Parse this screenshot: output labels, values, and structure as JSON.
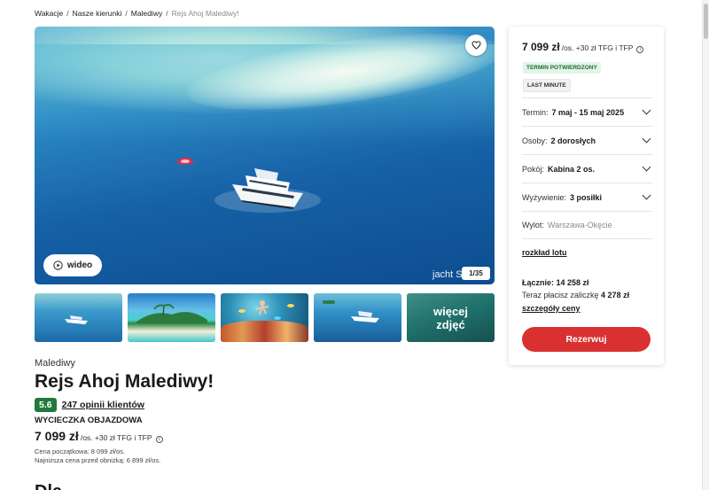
{
  "breadcrumb": {
    "items": [
      "Wakacje",
      "Nasze kierunki",
      "Malediwy"
    ],
    "current": "Rejs Ahoj Malediwy!",
    "separator": "/"
  },
  "gallery": {
    "video_label": "wideo",
    "watermark": "jacht S",
    "counter": "1/35",
    "more_photos": "więcej zdjęć"
  },
  "offer": {
    "destination": "Malediwy",
    "title": "Rejs Ahoj Malediwy!",
    "rating": "5.6",
    "reviews": "247 opinii klientów",
    "trip_type": "WYCIECZKA OBJAZDOWA",
    "price": "7 099 zł",
    "price_suffix": "/os. +30 zł TFG i TFP",
    "initial_price": "Cena początkowa: 8 099 zł/os.",
    "lowest_price": "Najniższa cena przed obniżką: 6 899 zł/os.",
    "next_section": "Dla"
  },
  "booking": {
    "price": "7 099 zł",
    "price_suffix": "/os. +30 zł TFG i TFP",
    "tag_confirmed": "TERMIN POTWIERDZONY",
    "tag_last_minute": "LAST MINUTE",
    "date_label": "Termin:",
    "date_value": "7 maj - 15 maj 2025",
    "people_label": "Osoby:",
    "people_value": "2 dorosłych",
    "room_label": "Pokój:",
    "room_value": "Kabina 2 os.",
    "board_label": "Wyżywienie:",
    "board_value": "3 posiłki",
    "flight_label": "Wylot:",
    "flight_value": "Warszawa-Okęcie",
    "flight_schedule": "rozkład lotu",
    "total": "Łącznie: 14 258 zł",
    "deposit_prefix": "Teraz płacisz zaliczkę",
    "deposit_value": "4 278 zł",
    "details_link": "szczegóły ceny",
    "book_button": "Rezerwuj"
  },
  "colors": {
    "accent_red": "#d93131",
    "rating_green": "#1f7a3a",
    "tag_green_bg": "#e3f4e8"
  },
  "icons": [
    "heart-icon",
    "play-circle-icon",
    "info-icon",
    "chevron-down-icon"
  ]
}
